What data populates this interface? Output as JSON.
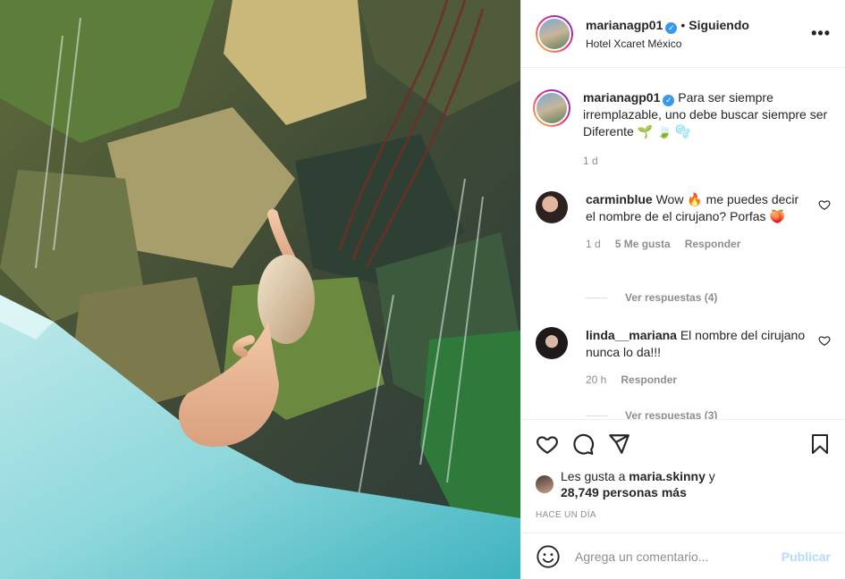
{
  "header": {
    "username": "marianagp01",
    "separator": "•",
    "follow_status": "Siguiendo",
    "location": "Hotel Xcaret México",
    "more_icon": "more-horizontal-icon"
  },
  "caption": {
    "username": "marianagp01",
    "text": "Para ser siempre irremplazable, uno debe buscar siempre ser Diferente 🌱 🍃 🫧",
    "time": "1 d"
  },
  "comments": [
    {
      "username": "carminblue",
      "text": "Wow 🔥 me puedes decir el nombre de el cirujano? Porfas 🍑",
      "time": "1 d",
      "likes": "5 Me gusta",
      "reply_label": "Responder",
      "view_replies": "Ver respuestas (4)"
    },
    {
      "username": "linda__mariana",
      "text": "El nombre del cirujano nunca lo da!!!",
      "time": "20 h",
      "reply_label": "Responder",
      "view_replies": "Ver respuestas (3)"
    }
  ],
  "likes": {
    "prefix": "Les gusta a",
    "user": "maria.skinny",
    "joiner": "y",
    "others": "28,749 personas más"
  },
  "timestamp": "HACE UN DÍA",
  "add_comment": {
    "placeholder": "Agrega un comentario...",
    "publish_label": "Publicar"
  },
  "colors": {
    "verified": "#3897f0",
    "publish_disabled": "#b3dbff",
    "muted_text": "#8e8e8e"
  }
}
